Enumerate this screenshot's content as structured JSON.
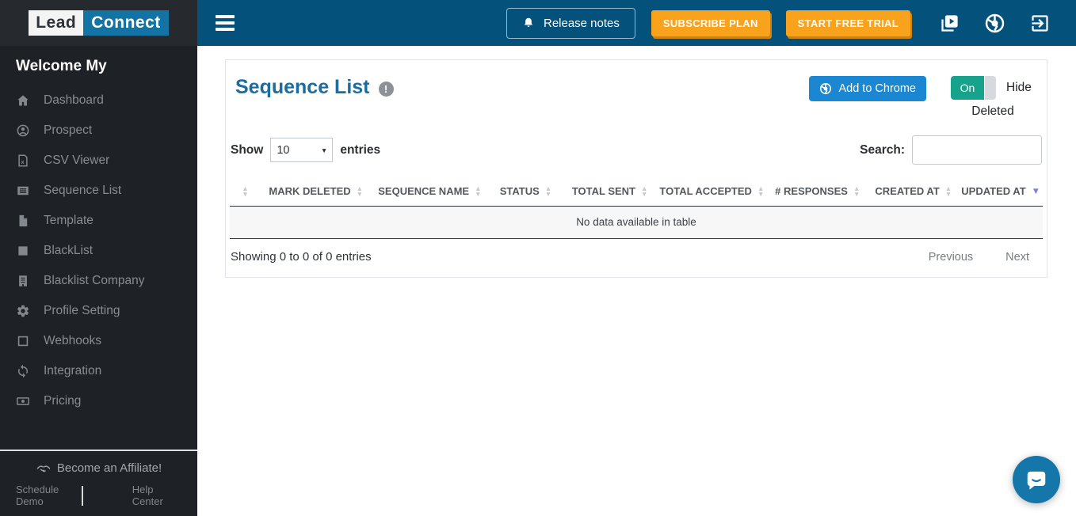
{
  "app": {
    "logo_lead": "Lead",
    "logo_connect": "Connect"
  },
  "colors": {
    "topbar_blue": "#04527c",
    "sidebar_bg": "#1e2126",
    "orange_button": "#f9a21c",
    "title_blue": "#1a6d9e",
    "add_to_chrome_blue": "#1b87d2",
    "toggle_teal": "#17a28b",
    "active_sort_arrow": "#7d81d9",
    "intercom_blue": "#1577a9"
  },
  "topbar": {
    "release_notes_label": "Release notes",
    "subscribe_label": "SUBSCRIBE PLAN",
    "trial_label": "START FREE TRIAL"
  },
  "sidebar": {
    "welcome": "Welcome My",
    "items": [
      {
        "label": "Dashboard",
        "icon": "home-icon"
      },
      {
        "label": "Prospect",
        "icon": "person-icon"
      },
      {
        "label": "CSV Viewer",
        "icon": "csv-file-icon"
      },
      {
        "label": "Sequence List",
        "icon": "list-icon"
      },
      {
        "label": "Template",
        "icon": "file-icon"
      },
      {
        "label": "BlackList",
        "icon": "square-icon"
      },
      {
        "label": "Blacklist Company",
        "icon": "building-icon"
      },
      {
        "label": "Profile Setting",
        "icon": "gear-icon"
      },
      {
        "label": "Webhooks",
        "icon": "square-outline-icon"
      },
      {
        "label": "Integration",
        "icon": "sync-icon"
      },
      {
        "label": "Pricing",
        "icon": "money-icon"
      }
    ],
    "affiliate_label": "Become an Affiliate!",
    "schedule_demo_label": "Schedule Demo",
    "help_center_label": "Help Center"
  },
  "main": {
    "title": "Sequence List",
    "add_to_chrome_label": "Add to Chrome",
    "toggle_on_label": "On",
    "toggle_label": "Hide Deleted",
    "show_label": "Show",
    "page_length_value": "10",
    "entries_label": "entries",
    "search_label": "Search:",
    "search_value": "",
    "table": {
      "columns": [
        "",
        "MARK DELETED",
        "SEQUENCE NAME",
        "STATUS",
        "TOTAL SENT",
        "TOTAL ACCEPTED",
        "# RESPONSES",
        "CREATED AT",
        "UPDATED AT"
      ],
      "sorted_by": "UPDATED AT",
      "sort_direction": "desc",
      "empty_message": "No data available in table",
      "info": "Showing 0 to 0 of 0 entries",
      "previous_label": "Previous",
      "next_label": "Next"
    }
  },
  "icons": {
    "info": "!",
    "sort_asc": "▲",
    "sort_desc": "▼",
    "hamburger-icon": "menu bars",
    "bell-icon": "notification bell",
    "video-library-icon": "video tutorials",
    "chrome-icon": "chrome browser",
    "logout-icon": "sign out",
    "handshake-icon": "affiliate handshake",
    "chat-bubble-icon": "intercom messenger"
  }
}
